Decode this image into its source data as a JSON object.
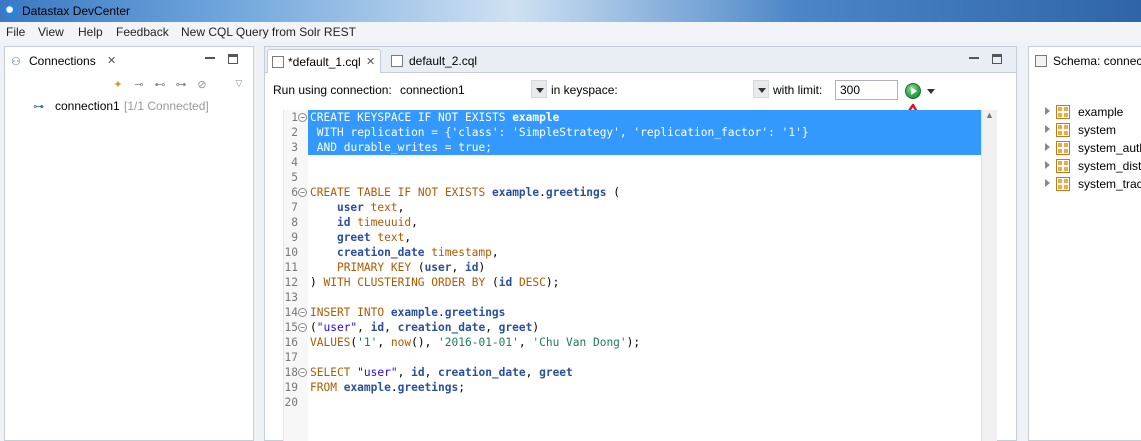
{
  "window": {
    "title": "Datastax DevCenter"
  },
  "menu": [
    "File",
    "View",
    "Help",
    "Feedback",
    "New CQL Query from Solr REST"
  ],
  "connections_view": {
    "tab_label": "Connections",
    "tree": [
      {
        "name": "connection1",
        "status": "[1/1 Connected]"
      }
    ]
  },
  "editor": {
    "tabs": [
      {
        "label": "*default_1.cql",
        "active": true
      },
      {
        "label": "default_2.cql",
        "active": false
      }
    ],
    "run_label": "Run using connection:",
    "connection_value": "connection1",
    "keyspace_label": "in keyspace:",
    "keyspace_value": "",
    "limit_label": "with limit:",
    "limit_value": "300",
    "lines": [
      "CREATE KEYSPACE IF NOT EXISTS example",
      " WITH replication = {'class': 'SimpleStrategy', 'replication_factor': '1'}",
      " AND durable_writes = true;",
      "",
      "",
      "CREATE TABLE IF NOT EXISTS example.greetings (",
      "    user text,",
      "    id timeuuid,",
      "    greet text,",
      "    creation_date timestamp,",
      "    PRIMARY KEY (user, id)",
      ") WITH CLUSTERING ORDER BY (id DESC);",
      "",
      "INSERT INTO example.greetings",
      "(\"user\", id, creation_date, greet)",
      "VALUES('1', now(), '2016-01-01', 'Chu Van Dong');",
      "",
      "SELECT \"user\", id, creation_date, greet",
      "FROM example.greetings;",
      ""
    ]
  },
  "schema_view": {
    "tab_label": "Schema: connect",
    "keyspaces": [
      "example",
      "system",
      "system_auth",
      "system_distr",
      "system_trac"
    ]
  },
  "colors": {
    "selection": "#3399ff",
    "keyword": "#b05a00",
    "identifier": "#2a4f9e",
    "string": "#2a00ff",
    "annotation": "#e01010"
  }
}
